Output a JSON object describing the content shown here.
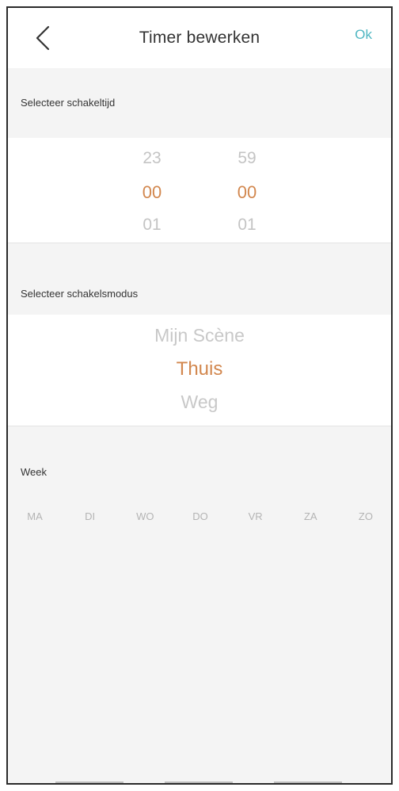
{
  "header": {
    "title": "Timer bewerken",
    "ok_label": "Ok"
  },
  "time": {
    "section_label": "Selecteer schakeltijd",
    "hours": {
      "prev": "23",
      "selected": "00",
      "next": "01"
    },
    "minutes": {
      "prev": "59",
      "selected": "00",
      "next": "01"
    }
  },
  "mode": {
    "section_label": "Selecteer schakelsmodus",
    "options": [
      "Mijn Scène",
      "Thuis",
      "Weg"
    ],
    "selected_index": 1
  },
  "week": {
    "section_label": "Week",
    "days": [
      "MA",
      "DI",
      "WO",
      "DO",
      "VR",
      "ZA",
      "ZO"
    ]
  },
  "colors": {
    "accent": "#d2874e",
    "ok": "#4fb6c2"
  }
}
